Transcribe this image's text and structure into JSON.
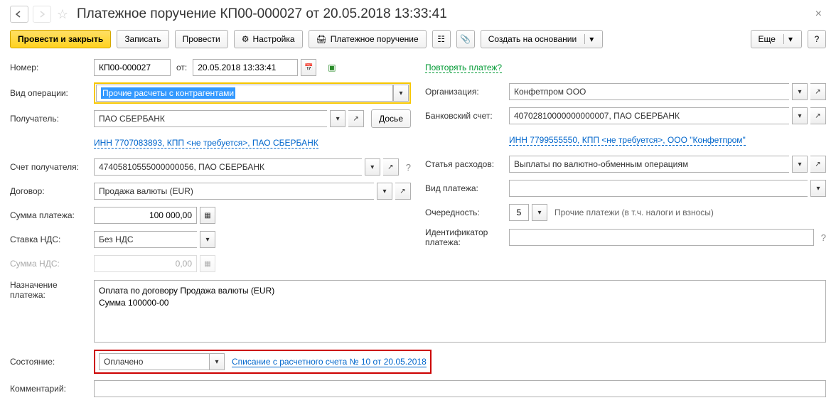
{
  "header": {
    "title": "Платежное поручение КП00-000027 от 20.05.2018 13:33:41"
  },
  "toolbar": {
    "post_close": "Провести и закрыть",
    "save": "Записать",
    "post": "Провести",
    "settings": "Настройка",
    "print_po": "Платежное поручение",
    "create_based": "Создать на основании",
    "more": "Еще",
    "help": "?"
  },
  "left": {
    "number_label": "Номер:",
    "number": "КП00-000027",
    "from_label": "от:",
    "date": "20.05.2018 13:33:41",
    "op_type_label": "Вид операции:",
    "op_type": "Прочие расчеты с контрагентами",
    "recipient_label": "Получатель:",
    "recipient": "ПАО СБЕРБАНК",
    "dossier": "Досье",
    "inn_link": "ИНН 7707083893, КПП <не требуется>, ПАО СБЕРБАНК",
    "recip_account_label": "Счет получателя:",
    "recip_account": "47405810555000000056, ПАО СБЕРБАНК",
    "contract_label": "Договор:",
    "contract": "Продажа валюты (EUR)",
    "amount_label": "Сумма платежа:",
    "amount": "100 000,00",
    "vat_rate_label": "Ставка НДС:",
    "vat_rate": "Без НДС",
    "vat_sum_label": "Сумма НДС:",
    "vat_sum": "0,00",
    "purpose_label": "Назначение платежа:",
    "purpose": "Оплата по договору Продажа валюты (EUR)\nСумма 100000-00",
    "status_label": "Состояние:",
    "status": "Оплачено",
    "status_link": "Списание с расчетного счета № 10 от 20.05.2018",
    "comment_label": "Комментарий:"
  },
  "right": {
    "repeat_link": "Повторять платеж?",
    "org_label": "Организация:",
    "org": "Конфетпром ООО",
    "bank_account_label": "Банковский счет:",
    "bank_account": "40702810000000000007, ПАО СБЕРБАНК",
    "org_inn_link": "ИНН 7799555550, КПП <не требуется>, ООО \"Конфетпром\"",
    "expense_label": "Статья расходов:",
    "expense": "Выплаты по валютно-обменным операциям",
    "pay_type_label": "Вид платежа:",
    "priority_label": "Очередность:",
    "priority": "5",
    "priority_hint": "Прочие платежи (в т.ч. налоги и взносы)",
    "payment_id_label": "Идентификатор платежа:"
  }
}
